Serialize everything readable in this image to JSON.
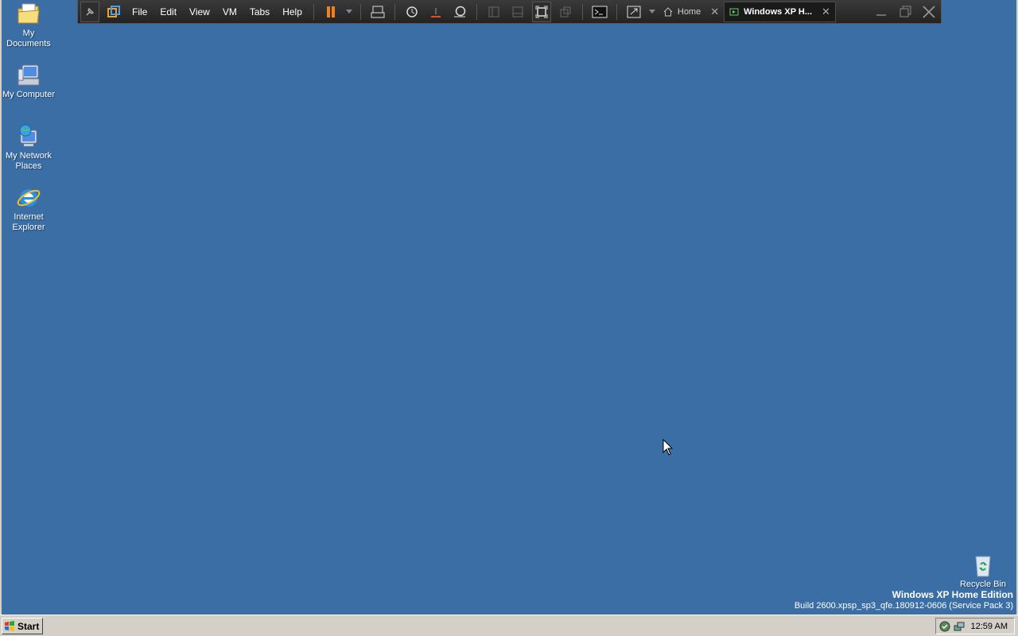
{
  "desktop": {
    "icons": [
      {
        "label": "My Documents"
      },
      {
        "label": "My Computer"
      },
      {
        "label": "My Network Places"
      },
      {
        "label": "Internet Explorer"
      }
    ],
    "recycle_bin": {
      "label": "Recycle Bin"
    },
    "watermark": {
      "edition": "Windows XP Home Edition",
      "build": "Build 2600.xpsp_sp3_qfe.180912-0606 (Service Pack 3)"
    },
    "background_color": "#3a6ea5"
  },
  "vm_toolbar": {
    "menus": [
      "File",
      "Edit",
      "View",
      "VM",
      "Tabs",
      "Help"
    ],
    "tabs": [
      {
        "label": "Home",
        "active": false
      },
      {
        "label": "Windows XP H...",
        "active": true
      }
    ],
    "icons": [
      "pin-icon",
      "vmware-logo-icon",
      "pause-icon",
      "dropdown-icon",
      "send-ctrl-alt-del-icon",
      "snapshot-icon",
      "revert-snapshot-icon",
      "snapshot-manager-icon",
      "thumbnail-view-icon",
      "console-view-icon",
      "fullscreen-icon",
      "unity-icon",
      "terminal-icon",
      "stretch-icon",
      "minimize-icon",
      "restore-icon",
      "close-icon"
    ]
  },
  "taskbar": {
    "start_label": "Start",
    "clock": "12:59 AM"
  }
}
